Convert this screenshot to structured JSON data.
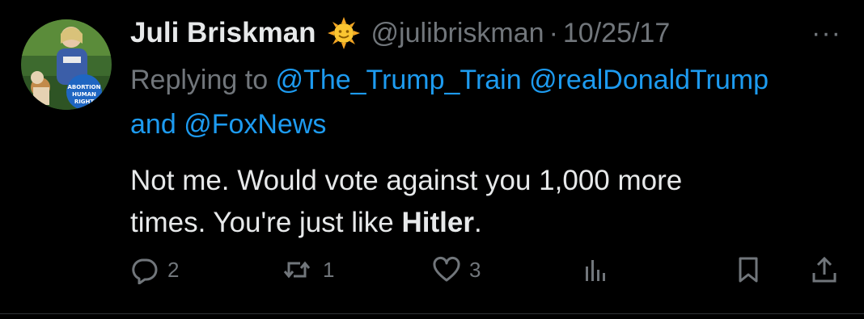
{
  "author": {
    "name": "Juli Briskman",
    "emoji_badge": "sun-with-face-icon",
    "handle": "@julibriskman",
    "separator": "·",
    "date": "10/25/17"
  },
  "more_label": "···",
  "reply": {
    "prefix": "Replying to ",
    "mention1": "@The_Trump_Train",
    "mention2": "@realDonaldTrump",
    "joiner": "and ",
    "mention3": "@FoxNews"
  },
  "tweet_text": {
    "line1": "Not me. Would vote against you 1,000 more",
    "line2_start": "times. You're just like ",
    "line2_bold": "Hitler",
    "line2_end": "."
  },
  "actions": {
    "replies": "2",
    "retweets": "1",
    "likes": "3"
  },
  "colors": {
    "background": "#000000",
    "text": "#e7e9ea",
    "muted": "#71767b",
    "link": "#1d9bf0"
  }
}
